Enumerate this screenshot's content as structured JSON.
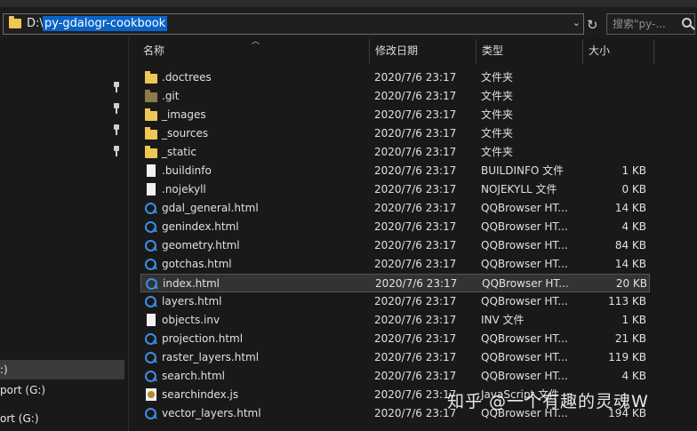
{
  "address": {
    "prefix": "D:\\",
    "selected": "py-gdalogr-cookbook",
    "dropdown_glyph": "⌄",
    "refresh_glyph": "↻",
    "search_placeholder": "搜索\"py-..."
  },
  "nav": {
    "items": [
      {
        "label": ":)",
        "selected": true
      },
      {
        "label": "port (G:)",
        "selected": false
      },
      {
        "label": "ort (G:)",
        "selected": false
      }
    ]
  },
  "columns": {
    "name": "名称",
    "date": "修改日期",
    "type": "类型",
    "size": "大小"
  },
  "files": [
    {
      "name": ".doctrees",
      "date": "2020/7/6 23:17",
      "type": "文件夹",
      "size": "",
      "icon": "folder"
    },
    {
      "name": ".git",
      "date": "2020/7/6 23:17",
      "type": "文件夹",
      "size": "",
      "icon": "folder-git"
    },
    {
      "name": "_images",
      "date": "2020/7/6 23:17",
      "type": "文件夹",
      "size": "",
      "icon": "folder"
    },
    {
      "name": "_sources",
      "date": "2020/7/6 23:17",
      "type": "文件夹",
      "size": "",
      "icon": "folder"
    },
    {
      "name": "_static",
      "date": "2020/7/6 23:17",
      "type": "文件夹",
      "size": "",
      "icon": "folder"
    },
    {
      "name": ".buildinfo",
      "date": "2020/7/6 23:17",
      "type": "BUILDINFO 文件",
      "size": "1 KB",
      "icon": "file"
    },
    {
      "name": ".nojekyll",
      "date": "2020/7/6 23:17",
      "type": "NOJEKYLL 文件",
      "size": "0 KB",
      "icon": "file"
    },
    {
      "name": "gdal_general.html",
      "date": "2020/7/6 23:17",
      "type": "QQBrowser HT...",
      "size": "14 KB",
      "icon": "browser"
    },
    {
      "name": "genindex.html",
      "date": "2020/7/6 23:17",
      "type": "QQBrowser HT...",
      "size": "4 KB",
      "icon": "browser"
    },
    {
      "name": "geometry.html",
      "date": "2020/7/6 23:17",
      "type": "QQBrowser HT...",
      "size": "84 KB",
      "icon": "browser"
    },
    {
      "name": "gotchas.html",
      "date": "2020/7/6 23:17",
      "type": "QQBrowser HT...",
      "size": "14 KB",
      "icon": "browser"
    },
    {
      "name": "index.html",
      "date": "2020/7/6 23:17",
      "type": "QQBrowser HT...",
      "size": "20 KB",
      "icon": "browser",
      "selected": true
    },
    {
      "name": "layers.html",
      "date": "2020/7/6 23:17",
      "type": "QQBrowser HT...",
      "size": "113 KB",
      "icon": "browser"
    },
    {
      "name": "objects.inv",
      "date": "2020/7/6 23:17",
      "type": "INV 文件",
      "size": "1 KB",
      "icon": "file"
    },
    {
      "name": "projection.html",
      "date": "2020/7/6 23:17",
      "type": "QQBrowser HT...",
      "size": "21 KB",
      "icon": "browser"
    },
    {
      "name": "raster_layers.html",
      "date": "2020/7/6 23:17",
      "type": "QQBrowser HT...",
      "size": "119 KB",
      "icon": "browser"
    },
    {
      "name": "search.html",
      "date": "2020/7/6 23:17",
      "type": "QQBrowser HT...",
      "size": "4 KB",
      "icon": "browser"
    },
    {
      "name": "searchindex.js",
      "date": "2020/7/6 23:17",
      "type": "JavaScript 文件",
      "size": "",
      "icon": "js"
    },
    {
      "name": "vector_layers.html",
      "date": "2020/7/6 23:17",
      "type": "QQBrowser HT...",
      "size": "194 KB",
      "icon": "browser"
    }
  ],
  "watermark": "知乎 @一个有趣的灵魂W"
}
